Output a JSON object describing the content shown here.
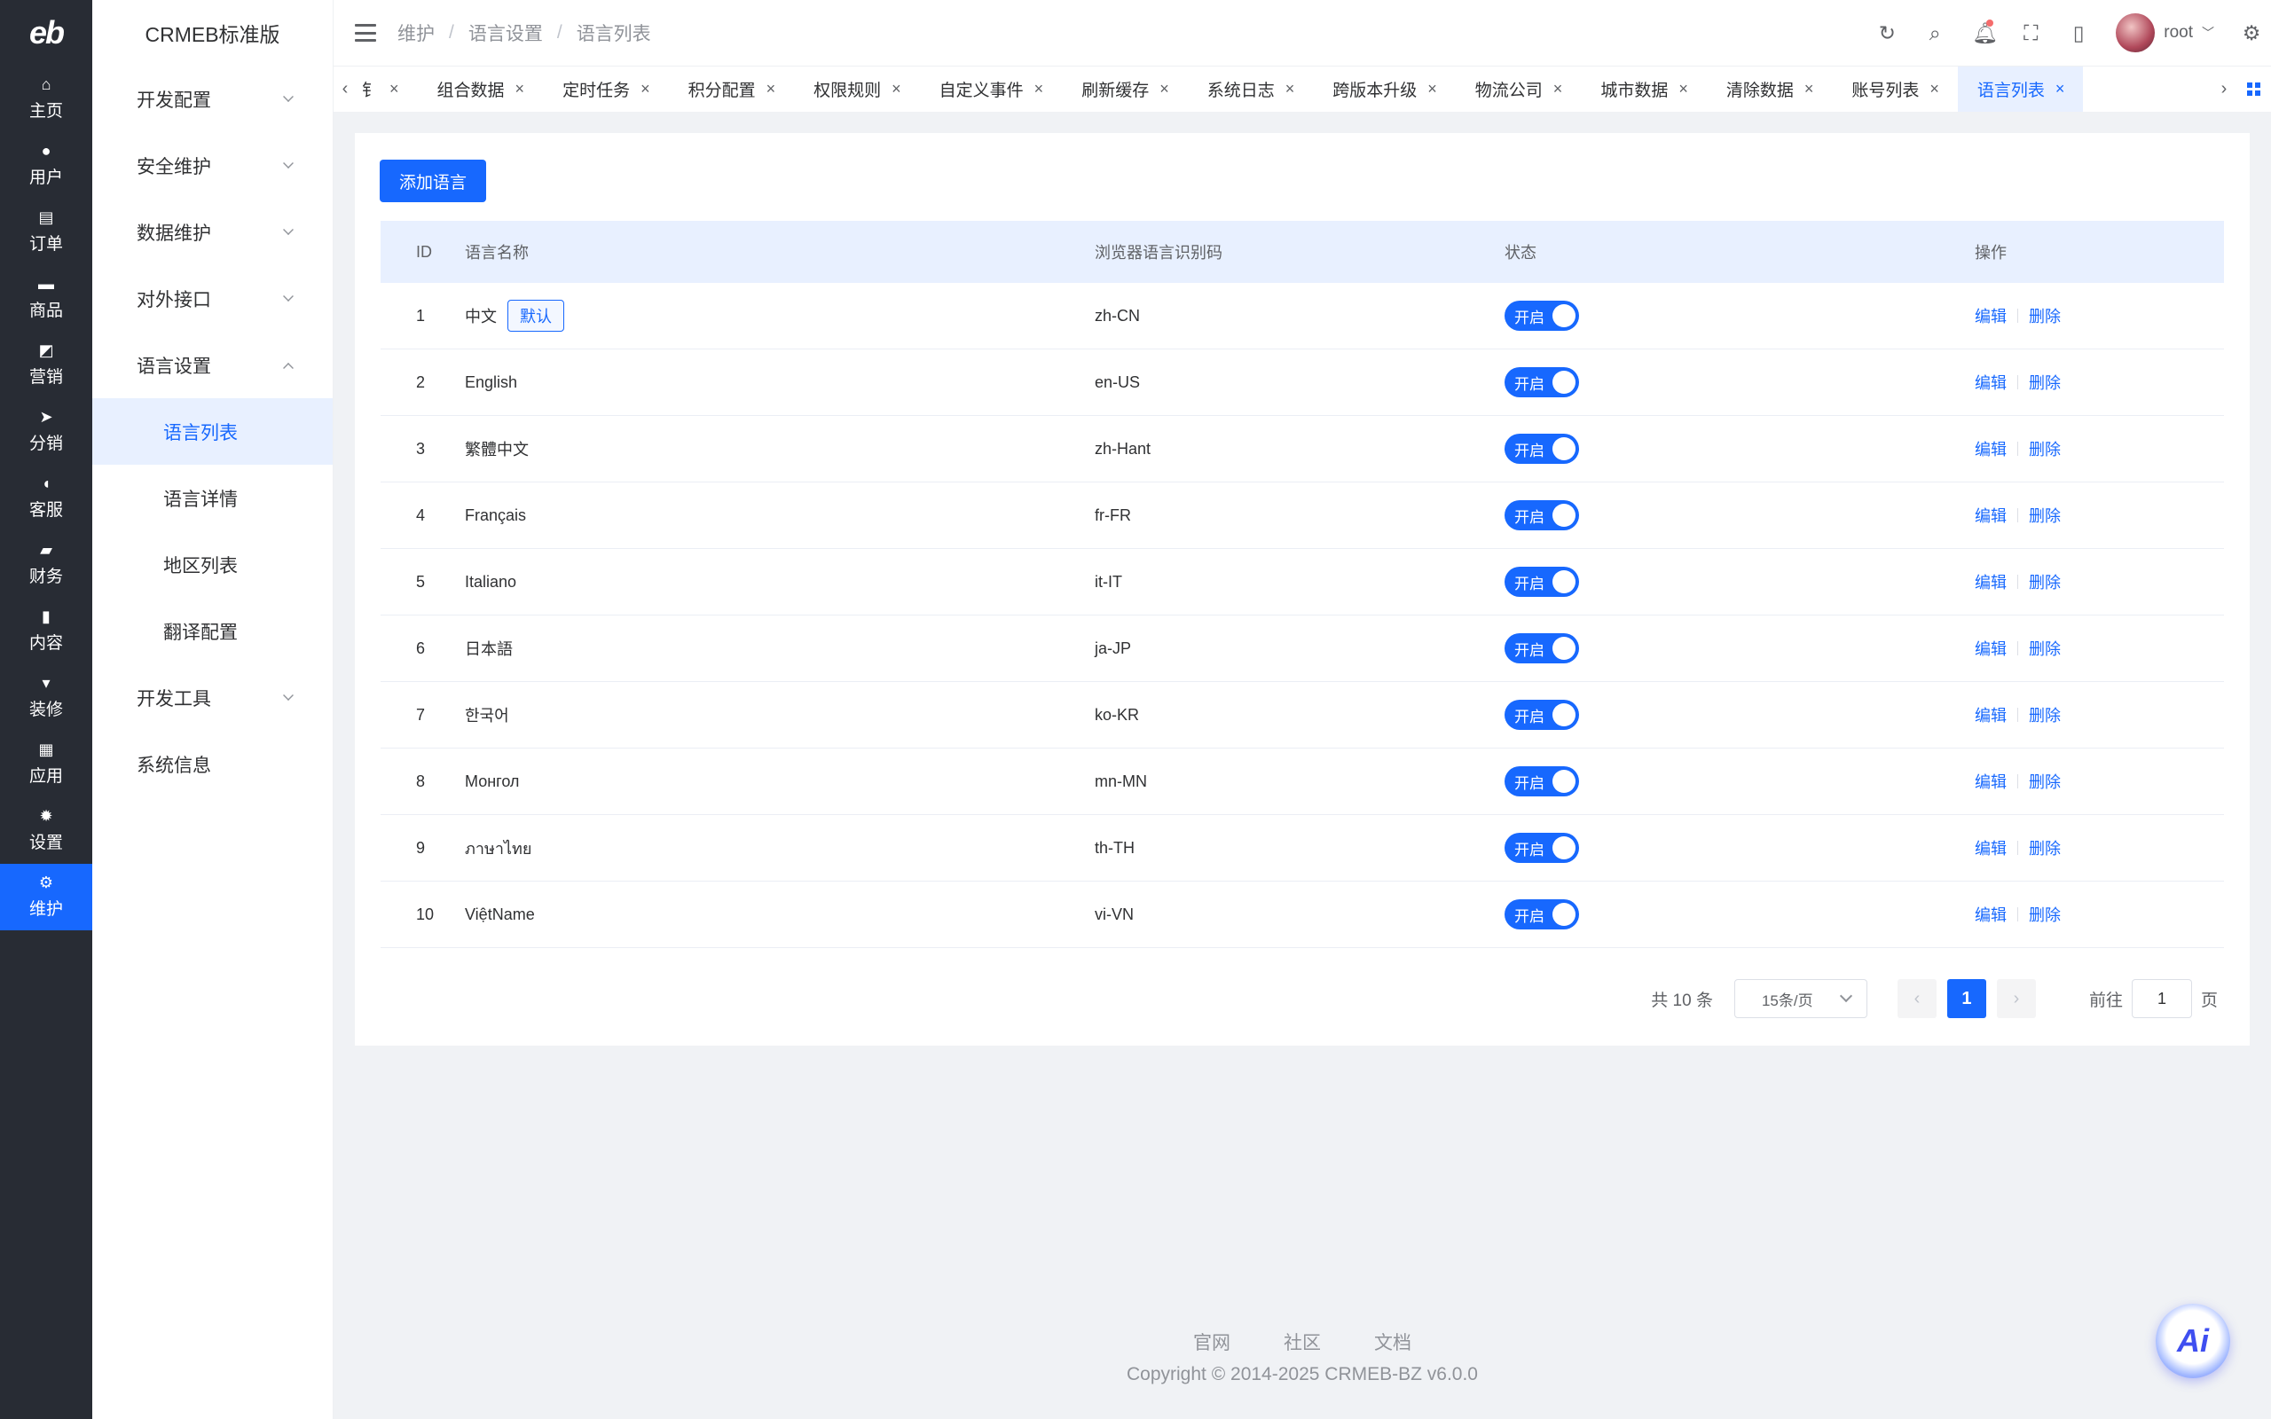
{
  "rail": {
    "logo": "eb",
    "items": [
      {
        "label": "主页",
        "icon": "⌂"
      },
      {
        "label": "用户",
        "icon": "●"
      },
      {
        "label": "订单",
        "icon": "▤"
      },
      {
        "label": "商品",
        "icon": "▬"
      },
      {
        "label": "营销",
        "icon": "◩"
      },
      {
        "label": "分销",
        "icon": "➤"
      },
      {
        "label": "客服",
        "icon": "◖"
      },
      {
        "label": "财务",
        "icon": "▰"
      },
      {
        "label": "内容",
        "icon": "▮"
      },
      {
        "label": "装修",
        "icon": "▾"
      },
      {
        "label": "应用",
        "icon": "▦"
      },
      {
        "label": "设置",
        "icon": "✹"
      },
      {
        "label": "维护",
        "icon": "⚙"
      }
    ]
  },
  "submenu": {
    "brand": "CRMEB标准版",
    "items": [
      "开发配置",
      "安全维护",
      "数据维护",
      "对外接口",
      "语言设置"
    ],
    "sub_items": [
      "语言列表",
      "语言详情",
      "地区列表",
      "翻译配置"
    ],
    "after": [
      "开发工具",
      "系统信息"
    ]
  },
  "header": {
    "crumbs": [
      "维护",
      "语言设置",
      "语言列表"
    ],
    "user": "root"
  },
  "tabs": {
    "partial": "钅",
    "items": [
      "组合数据",
      "定时任务",
      "积分配置",
      "权限规则",
      "自定义事件",
      "刷新缓存",
      "系统日志",
      "跨版本升级",
      "物流公司",
      "城市数据",
      "清除数据",
      "账号列表",
      "语言列表"
    ]
  },
  "page": {
    "add_button": "添加语言",
    "columns": {
      "id": "ID",
      "name": "语言名称",
      "code": "浏览器语言识别码",
      "status": "状态",
      "ops": "操作"
    },
    "rows": [
      {
        "id": "1",
        "name": "中文",
        "tag": "默认",
        "code": "zh-CN",
        "status": "开启"
      },
      {
        "id": "2",
        "name": "English",
        "code": "en-US",
        "status": "开启"
      },
      {
        "id": "3",
        "name": "繁體中文",
        "code": "zh-Hant",
        "status": "开启"
      },
      {
        "id": "4",
        "name": "Français",
        "code": "fr-FR",
        "status": "开启"
      },
      {
        "id": "5",
        "name": "Italiano",
        "code": "it-IT",
        "status": "开启"
      },
      {
        "id": "6",
        "name": "日本語",
        "code": "ja-JP",
        "status": "开启"
      },
      {
        "id": "7",
        "name": "한국어",
        "code": "ko-KR",
        "status": "开启"
      },
      {
        "id": "8",
        "name": "Монгол",
        "code": "mn-MN",
        "status": "开启"
      },
      {
        "id": "9",
        "name": "ภาษาไทย",
        "code": "th-TH",
        "status": "开启"
      },
      {
        "id": "10",
        "name": "ViệtName",
        "code": "vi-VN",
        "status": "开启"
      }
    ],
    "edit": "编辑",
    "delete": "删除"
  },
  "pagination": {
    "total": "共 10 条",
    "page_size": "15条/页",
    "current": "1",
    "goto_label": "前往",
    "goto_value": "1",
    "page_unit": "页"
  },
  "footer": {
    "links": [
      "官网",
      "社区",
      "文档"
    ],
    "copyright": "Copyright © 2014-2025 CRMEB-BZ v6.0.0"
  },
  "ai_label": "Ai",
  "colors": {
    "primary": "#1768fe",
    "rail_bg": "#282c34"
  }
}
